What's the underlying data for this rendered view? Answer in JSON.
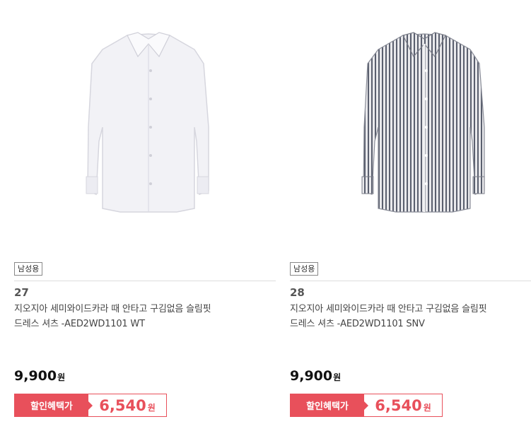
{
  "products": [
    {
      "tag": "남성용",
      "rank": "27",
      "title_line1": "지오지아 세미와이드카라 때 안타고 구김없음 슬림핏",
      "title_line2": "드레스 셔츠 -AED2WD1101 WT",
      "price": "9,900",
      "price_unit": "원",
      "discount_label": "할인혜택가",
      "discount_price": "6,540",
      "discount_unit": "원",
      "image": "white-dress-shirt"
    },
    {
      "tag": "남성용",
      "rank": "28",
      "title_line1": "지오지아 세미와이드카라 때 안타고 구김없음 슬림핏",
      "title_line2": "드레스 셔츠 -AED2WD1101 SNV",
      "price": "9,900",
      "price_unit": "원",
      "discount_label": "할인혜택가",
      "discount_price": "6,540",
      "discount_unit": "원",
      "image": "striped-dress-shirt"
    }
  ],
  "colors": {
    "accent": "#e8505b",
    "text": "#333333"
  }
}
